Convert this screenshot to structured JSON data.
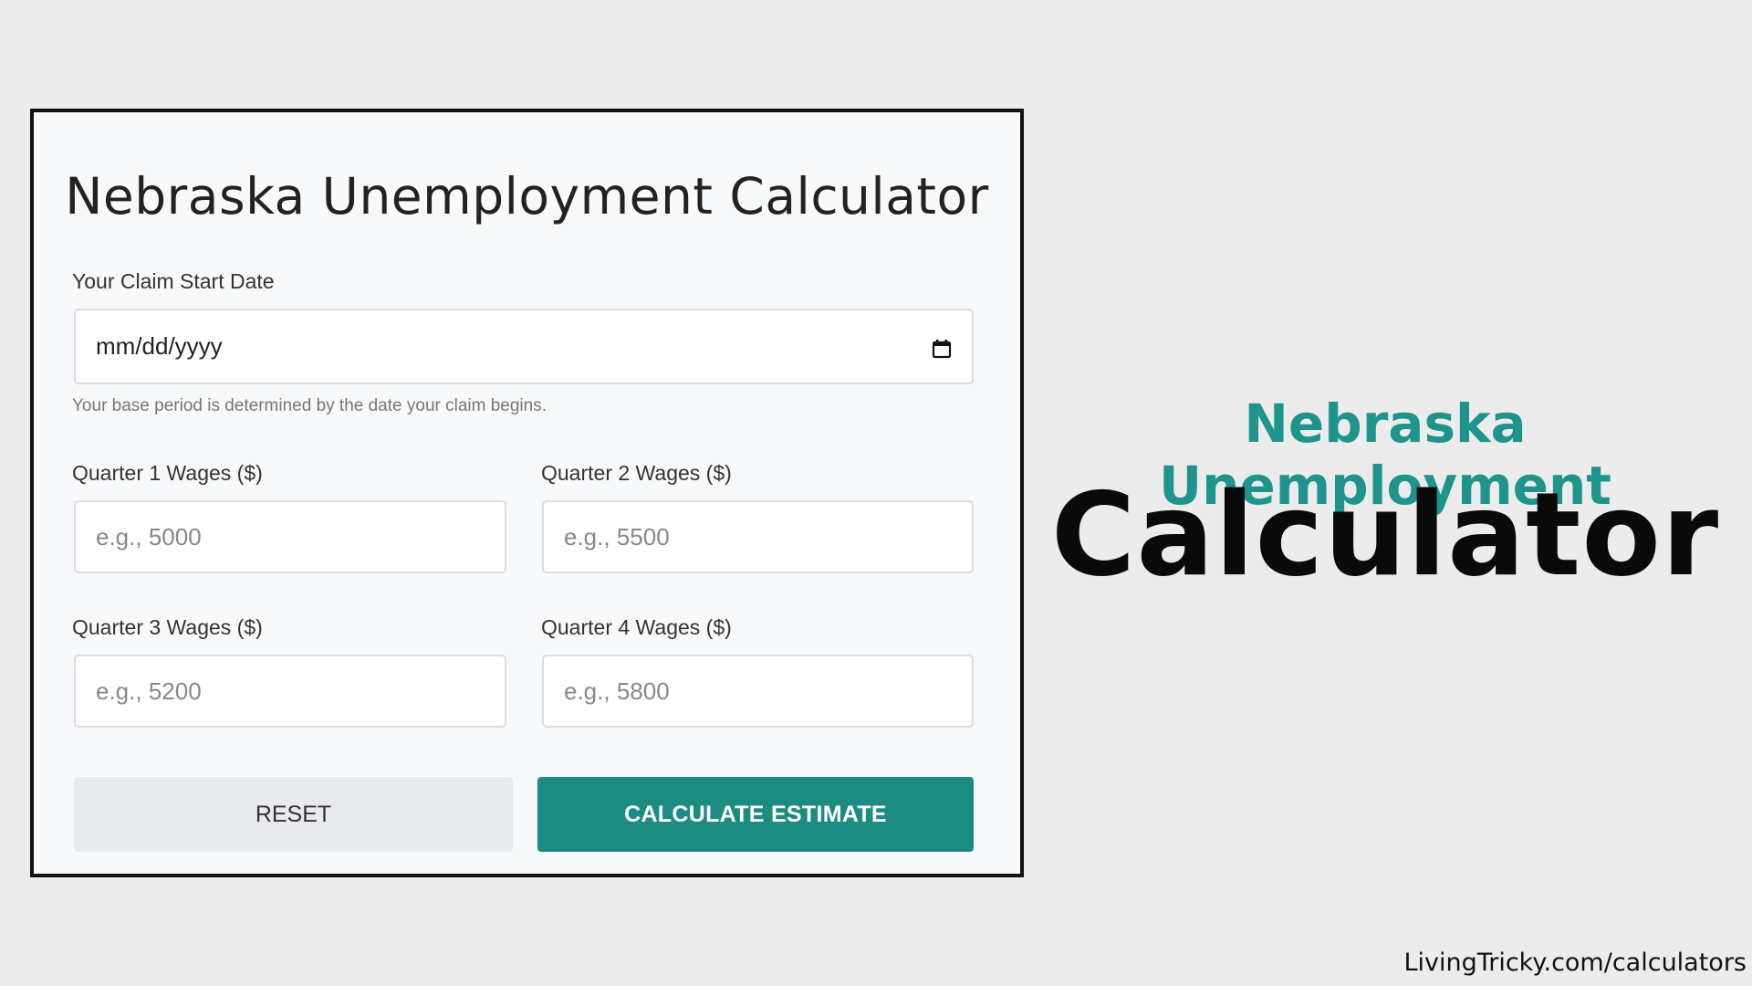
{
  "card": {
    "title": "Nebraska Unemployment Calculator",
    "claim_date": {
      "label": "Your Claim Start Date",
      "placeholder": "mm/dd/yyyy",
      "icon": "calendar-icon",
      "helper": "Your base period is determined by the date your claim begins."
    },
    "quarters": [
      {
        "label": "Quarter 1 Wages ($)",
        "placeholder": "e.g., 5000"
      },
      {
        "label": "Quarter 2 Wages ($)",
        "placeholder": "e.g., 5500"
      },
      {
        "label": "Quarter 3 Wages ($)",
        "placeholder": "e.g., 5200"
      },
      {
        "label": "Quarter 4 Wages ($)",
        "placeholder": "e.g., 5800"
      }
    ],
    "buttons": {
      "reset": "RESET",
      "calculate": "CALCULATE ESTIMATE"
    }
  },
  "hero": {
    "line1": "Nebraska Unemployment",
    "line2": "Calculator"
  },
  "footer": {
    "url": "LivingTricky.com/calculators"
  },
  "colors": {
    "accent": "#1c8c83",
    "heading_teal": "#1f948c",
    "background": "#ececec"
  }
}
